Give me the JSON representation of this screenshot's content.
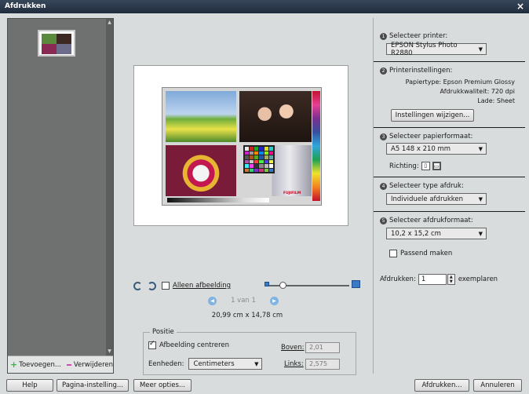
{
  "window": {
    "title": "Afdrukken",
    "close": "×"
  },
  "left_panel": {
    "add_label": "Toevoegen...",
    "remove_label": "Verwijderen"
  },
  "preview": {
    "watermark": "FUJIFILM",
    "only_image_label": "Alleen afbeelding",
    "pager_text": "1 van 1",
    "dimensions": "20,99 cm x 14,78 cm"
  },
  "position": {
    "legend": "Positie",
    "center_label": "Afbeelding centreren",
    "units_label": "Eenheden:",
    "units_value": "Centimeters",
    "top_label": "Boven:",
    "top_value": "2,01",
    "left_label": "Links:",
    "left_value": "2,575"
  },
  "right_panel": {
    "step1": {
      "num": "1",
      "label": "Selecteer printer:",
      "value": "EPSON Stylus Photo R2880"
    },
    "step2": {
      "num": "2",
      "label": "Printerinstellingen:",
      "paper_type": "Papiertype: Epson Premium Glossy",
      "quality": "Afdrukkwaliteit: 720 dpi",
      "tray": "Lade: Sheet",
      "button": "Instellingen wijzigen..."
    },
    "step3": {
      "num": "3",
      "label": "Selecteer papierformaat:",
      "value": "A5 148 x 210 mm",
      "orientation_label": "Richting:"
    },
    "step4": {
      "num": "4",
      "label": "Selecteer type afdruk:",
      "value": "Individuele afdrukken"
    },
    "step5": {
      "num": "5",
      "label": "Selecteer afdrukformaat:",
      "value": "10,2 x 15,2 cm",
      "fit_label": "Passend maken"
    },
    "copies_label": "Afdrukken:",
    "copies_value": "1",
    "copies_suffix": "exemplaren"
  },
  "footer": {
    "help": "Help",
    "page_setup": "Pagina-instelling...",
    "more_options": "Meer opties...",
    "print": "Afdrukken...",
    "cancel": "Annuleren"
  },
  "colors": {
    "accent": "#3a7ac2",
    "titlebar": "#2b3a4c",
    "add_icon": "#38b449",
    "remove_icon": "#d04ab0"
  },
  "icons": {
    "close": "close-icon",
    "rotate_left": "rotate-left-icon",
    "rotate_right": "rotate-right-icon",
    "prev": "chevron-left-icon",
    "next": "chevron-right-icon"
  }
}
